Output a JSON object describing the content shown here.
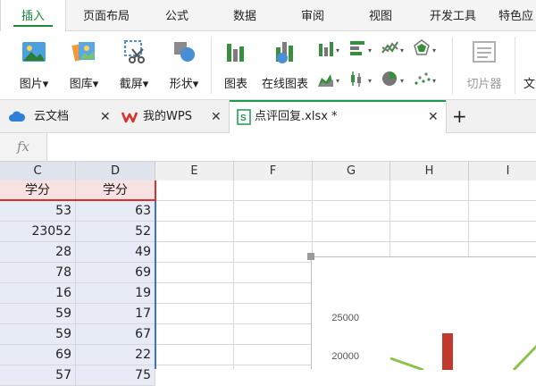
{
  "ribbon_tabs": [
    "插入",
    "页面布局",
    "公式",
    "数据",
    "审阅",
    "视图",
    "开发工具",
    "特色应"
  ],
  "ribbon_buttons": {
    "picture": "图片",
    "gallery": "图库",
    "screenshot": "截屏",
    "shapes": "形状",
    "chart": "图表",
    "online_chart": "在线图表",
    "slicer": "切片器",
    "text": "文"
  },
  "doc_tabs": {
    "cloud": "云文档",
    "wps": "我的WPS",
    "file": "点评回复.xlsx *"
  },
  "formula_bar": {
    "fx": "fx",
    "value": ""
  },
  "columns": [
    "C",
    "D",
    "E",
    "F",
    "G",
    "H",
    "I"
  ],
  "rows": [
    {
      "c": "学分",
      "d": "学分"
    },
    {
      "c": "53",
      "d": "63"
    },
    {
      "c": "23052",
      "d": "52"
    },
    {
      "c": "28",
      "d": "49"
    },
    {
      "c": "78",
      "d": "69"
    },
    {
      "c": "16",
      "d": "19"
    },
    {
      "c": "59",
      "d": "17"
    },
    {
      "c": "59",
      "d": "67"
    },
    {
      "c": "69",
      "d": "22"
    },
    {
      "c": "57",
      "d": "75"
    }
  ],
  "chart_data": {
    "type": "bar",
    "y_ticks": [
      "25000",
      "20000"
    ],
    "colors": {
      "bar": "#c0392b",
      "line": "#8bc34a"
    }
  },
  "colors": {
    "accent": "#1a8a3a",
    "wps_red": "#d9302c",
    "selection": "#3a6fd8"
  }
}
